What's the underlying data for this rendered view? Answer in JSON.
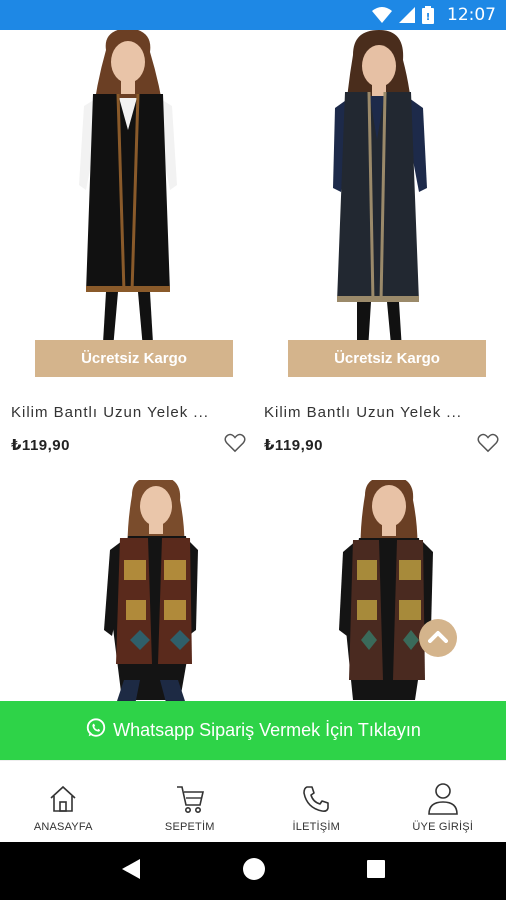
{
  "status_bar": {
    "time": "12:07",
    "background": "#1e88e5"
  },
  "products": [
    {
      "name": "Kilim Bantlı Uzun Yelek ...",
      "price": "₺119,90",
      "badge": "Ücretsiz Kargo"
    },
    {
      "name": "Kilim Bantlı Uzun Yelek ...",
      "price": "₺119,90",
      "badge": "Ücretsiz Kargo"
    },
    {
      "name": "",
      "price": "",
      "badge": ""
    },
    {
      "name": "",
      "price": "",
      "badge": ""
    }
  ],
  "whatsapp": {
    "label": "Whatsapp Sipariş Vermek İçin Tıklayın",
    "color": "#2ed348"
  },
  "bottom_nav": [
    {
      "label": "ANASAYFA",
      "icon": "home-icon"
    },
    {
      "label": "SEPETİM",
      "icon": "cart-icon"
    },
    {
      "label": "İLETİŞİM",
      "icon": "phone-icon"
    },
    {
      "label": "ÜYE GİRİŞİ",
      "icon": "user-icon"
    }
  ],
  "colors": {
    "accent": "#d4b48c",
    "whatsapp_green": "#2ed348",
    "status_blue": "#1e88e5"
  }
}
